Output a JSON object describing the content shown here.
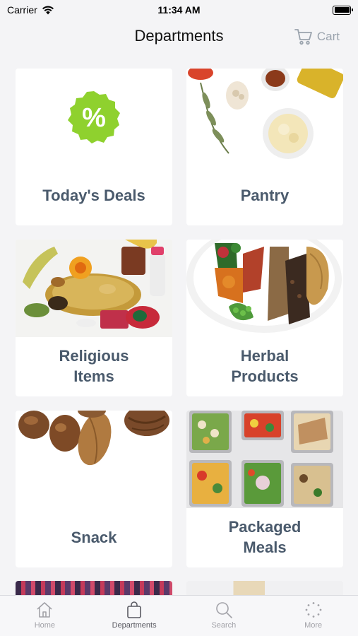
{
  "status_bar": {
    "carrier": "Carrier",
    "time": "11:34 AM"
  },
  "nav": {
    "title": "Departments",
    "cart_label": "Cart"
  },
  "departments": [
    {
      "label_lines": [
        "Today's Deals"
      ],
      "icon": "percent-badge-icon"
    },
    {
      "label_lines": [
        "Pantry"
      ],
      "icon": "pantry-photo"
    },
    {
      "label_lines": [
        "Religious",
        "Items"
      ],
      "icon": "religious-items-photo"
    },
    {
      "label_lines": [
        "Herbal",
        "Products"
      ],
      "icon": "herbal-products-photo"
    },
    {
      "label_lines": [
        "Snack"
      ],
      "icon": "snack-photo"
    },
    {
      "label_lines": [
        "Packaged",
        "Meals"
      ],
      "icon": "packaged-meals-photo"
    }
  ],
  "tabs": [
    {
      "label": "Home",
      "icon": "home-icon",
      "active": false
    },
    {
      "label": "Departments",
      "icon": "shopping-bag-icon",
      "active": true
    },
    {
      "label": "Search",
      "icon": "search-icon",
      "active": false
    },
    {
      "label": "More",
      "icon": "more-dots-icon",
      "active": false
    }
  ],
  "colors": {
    "deal_badge": "#8fd12e",
    "label_text": "#4a5a6c",
    "cart_text": "#9aa3ad"
  }
}
